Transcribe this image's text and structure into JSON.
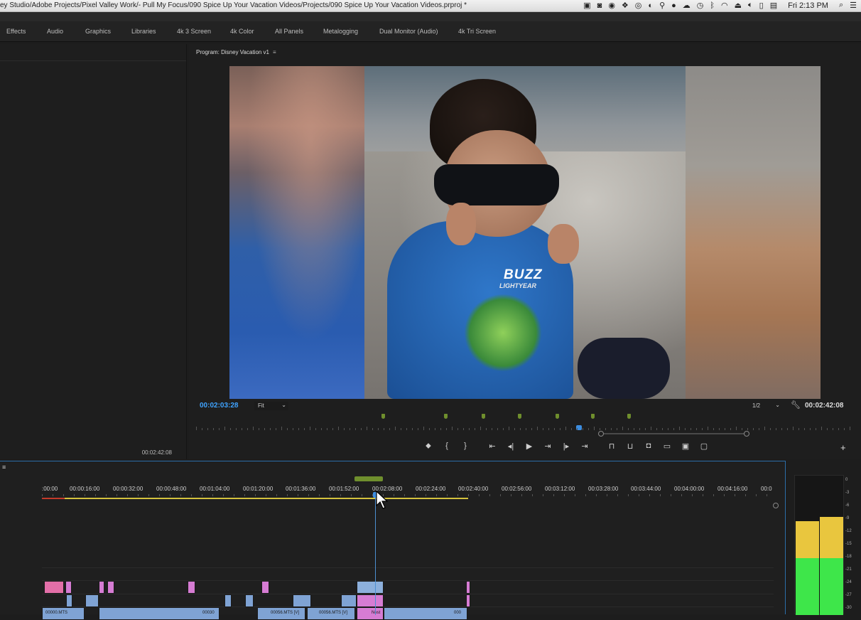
{
  "menubar": {
    "window_title": "ey Studio/Adobe Projects/Pixel Valley Work/- Pull My Focus/090 Spice Up Your Vacation Videos/Projects/090 Spice Up Your Vacation Videos.prproj *",
    "clock": "Fri 2:13 PM"
  },
  "workspaces": {
    "tabs": [
      "Effects",
      "Audio",
      "Graphics",
      "Libraries",
      "4k 3 Screen",
      "4k Color",
      "All Panels",
      "Metalogging",
      "Dual Monitor (Audio)",
      "4k Tri Screen"
    ]
  },
  "left_panel": {
    "timecode": "00:02:42:08"
  },
  "program_monitor": {
    "title": "Program: Disney Vacation v1",
    "current_timecode": "00:02:03:28",
    "zoom": "Fit",
    "resolution": "1/2",
    "duration": "00:02:42:08",
    "frame_text": {
      "shirt_line1": "BUZZ",
      "shirt_line2": "LIGHTYEAR"
    }
  },
  "timeline": {
    "ruler_labels": [
      ":00:00",
      "00:00:16:00",
      "00:00:32:00",
      "00:00:48:00",
      "00:01:04:00",
      "00:01:20:00",
      "00:01:36:00",
      "00:01:52:00",
      "00:02:08:00",
      "00:02:24:00",
      "00:02:40:00",
      "00:02:56:00",
      "00:03:12:00",
      "00:03:28:00",
      "00:03:44:00",
      "00:04:00:00",
      "00:04:16:00",
      "00:0"
    ],
    "clip_labels": {
      "c1": "00000.MTS",
      "c2": "00030",
      "c3": "00056.MTS [V]",
      "c4": "00056.MTS [V]",
      "c5": "Nest",
      "c6": "000"
    }
  },
  "audio_meter": {
    "db_labels": [
      "0",
      "-3",
      "-6",
      "-9",
      "-12",
      "-15",
      "-18",
      "-21",
      "-24",
      "-27",
      "-30"
    ],
    "colors": {
      "green": "#3ee64a",
      "yellow": "#e9c63e"
    }
  }
}
